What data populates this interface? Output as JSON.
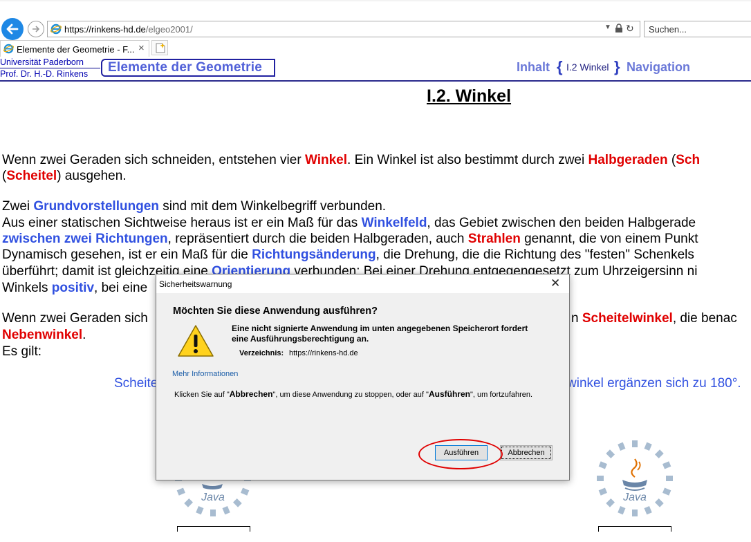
{
  "browser": {
    "url_host": "https://rinkens-hd.de",
    "url_path": "/elgeo2001/",
    "search_placeholder": "Suchen...",
    "tab_title": "Elemente der Geometrie - F...",
    "tab_close": "×"
  },
  "header": {
    "univ": "Universität Paderborn",
    "prof": "Prof. Dr. H.-D. Rinkens",
    "logo_title": "Elemente der Geometrie",
    "nav_inhalt": "Inhalt",
    "brace_open": "{",
    "nav_current": "I.2 Winkel",
    "brace_close": "}",
    "nav_navigation": "Navigation"
  },
  "page_title": "I.2. Winkel",
  "content": {
    "p1a": "Wenn zwei Geraden sich schneiden, entstehen vier ",
    "p1b": "Winkel",
    "p1c": ". Ein Winkel ist also bestimmt durch zwei ",
    "p1d": "Halbgeraden",
    "p1e": " (",
    "p1f": "Sch",
    "p2a": "(",
    "p2b": "Scheitel",
    "p2c": ") ausgehen.",
    "p3a": "Zwei ",
    "p3b": "Grundvorstellungen",
    "p3c": " sind mit dem Winkelbegriff verbunden.",
    "p4a": "Aus einer statischen Sichtweise heraus ist er ein Maß für das ",
    "p4b": "Winkelfeld",
    "p4c": ", das Gebiet zwischen den beiden Halbgerade",
    "p5a": "zwischen zwei Richtungen",
    "p5b": ", repräsentiert durch die beiden Halbgeraden, auch ",
    "p5c": "Strahlen",
    "p5d": " genannt, die von einem Punkt",
    "p6a": "Dynamisch gesehen, ist er ein Maß für die ",
    "p6b": "Richtungsänderung",
    "p6c": ", die Drehung, die die Richtung des \"festen\" Schenkels",
    "p7a": "überführt; damit ist gleichzeitig eine ",
    "p7b": "Orientierung",
    "p7c": " verbunden: Bei einer Drehung entgegengesetzt zum Uhrzeigersinn ni",
    "p8a": "Winkels ",
    "p8b": "positiv",
    "p8c": ", bei eine",
    "p9a": "Wenn zwei Geraden sich",
    "p9b": "n ",
    "p9c": "Scheitelwinkel",
    "p9d": ", die benac",
    "p10a": "Nebenwinkel",
    "p10b": ".",
    "p11": "Es gilt:",
    "formula_left": "Scheite",
    "formula_right": "winkel ergänzen sich zu 180°."
  },
  "java": {
    "label": "Java"
  },
  "dialog": {
    "title": "Sicherheitswarnung",
    "close": "✕",
    "heading": "Möchten Sie diese Anwendung ausführen?",
    "msg_line1": "Eine nicht signierte Anwendung im unten angegebenen Speicherort fordert",
    "msg_line2": "eine Ausführungsberechtigung an.",
    "dir_label": "Verzeichnis:",
    "dir_value": "https://rinkens-hd.de",
    "more_info": "Mehr Informationen",
    "instr_a": "Klicken Sie auf \"",
    "instr_b": "Abbrechen",
    "instr_c": "\", um diese Anwendung zu stoppen, oder auf \"",
    "instr_d": "Ausführen",
    "instr_e": "\", um fortzufahren.",
    "run_label": "Ausführen",
    "cancel_label": "Abbrechen"
  },
  "colors": {
    "accent_blue": "#3050e0",
    "emphasis_red": "#e00000",
    "browser_back": "#1e88e5"
  }
}
